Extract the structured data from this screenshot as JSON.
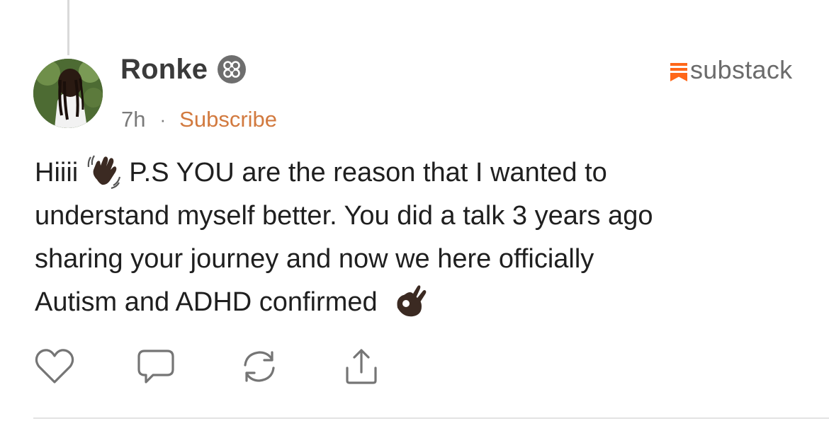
{
  "post": {
    "author_name": "Ronke",
    "timestamp": "7h",
    "separator": "·",
    "subscribe_label": "Subscribe",
    "brand_name": "substack",
    "lines": [
      {
        "text_before": "Hiiii",
        "emoji": "waving-hand-dark-skin-emoji",
        "text_after": "P.S YOU are the reason that I wanted to"
      },
      {
        "text": "understand myself better. You did a talk 3 years ago"
      },
      {
        "text": "sharing your journey and now we here officially"
      },
      {
        "text_before": "Autism and ADHD confirmed",
        "emoji": "ok-hand-dark-skin-emoji"
      }
    ]
  },
  "icons": {
    "badge": "verified-flower-badge-icon",
    "brand": "substack-logo-icon",
    "actions": [
      "heart-icon",
      "comment-icon",
      "restack-icon",
      "share-icon"
    ]
  },
  "colors": {
    "accent": "#d27a3f",
    "brand_orange": "#ff6719",
    "muted": "#7a7a7a",
    "text": "#1f1f1f"
  }
}
